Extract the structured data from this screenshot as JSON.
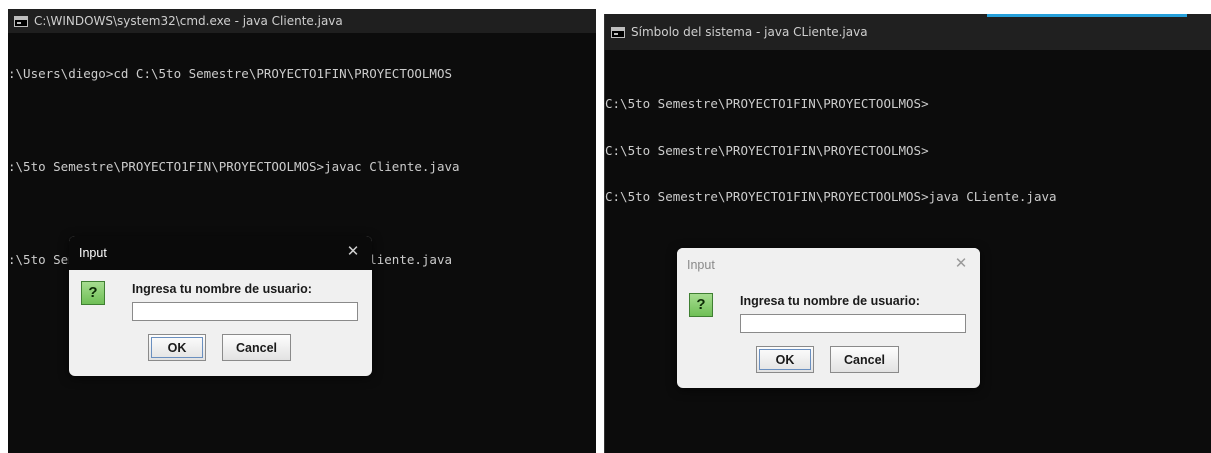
{
  "left_window": {
    "title": "C:\\WINDOWS\\system32\\cmd.exe - java  Cliente.java",
    "lines": [
      ":\\Users\\diego>cd C:\\5to Semestre\\PROYECTO1FIN\\PROYECTOOLMOS",
      "",
      ":\\5to Semestre\\PROYECTO1FIN\\PROYECTOOLMOS>javac Cliente.java",
      "",
      ":\\5to Semestre\\PROYECTO1FIN\\PROYECTOOLMOS>java Cliente.java"
    ],
    "dialog": {
      "title": "Input",
      "close_glyph": "✕",
      "icon_glyph": "?",
      "label": "Ingresa tu nombre de usuario:",
      "input_value": "",
      "ok_label": "OK",
      "cancel_label": "Cancel"
    }
  },
  "right_window": {
    "title": "Símbolo del sistema - java  CLiente.java",
    "lines": [
      "C:\\5to Semestre\\PROYECTO1FIN\\PROYECTOOLMOS>",
      "C:\\5to Semestre\\PROYECTO1FIN\\PROYECTOOLMOS>",
      "C:\\5to Semestre\\PROYECTO1FIN\\PROYECTOOLMOS>java CLiente.java"
    ],
    "dialog": {
      "title": "Input",
      "close_glyph": "✕",
      "icon_glyph": "?",
      "label": "Ingresa tu nombre de usuario:",
      "input_value": "",
      "ok_label": "OK",
      "cancel_label": "Cancel"
    }
  },
  "colors": {
    "console_bg": "#0c0c0c",
    "console_text": "#cccccc",
    "accent": "#26a0da",
    "question_icon": "#7cc463"
  }
}
